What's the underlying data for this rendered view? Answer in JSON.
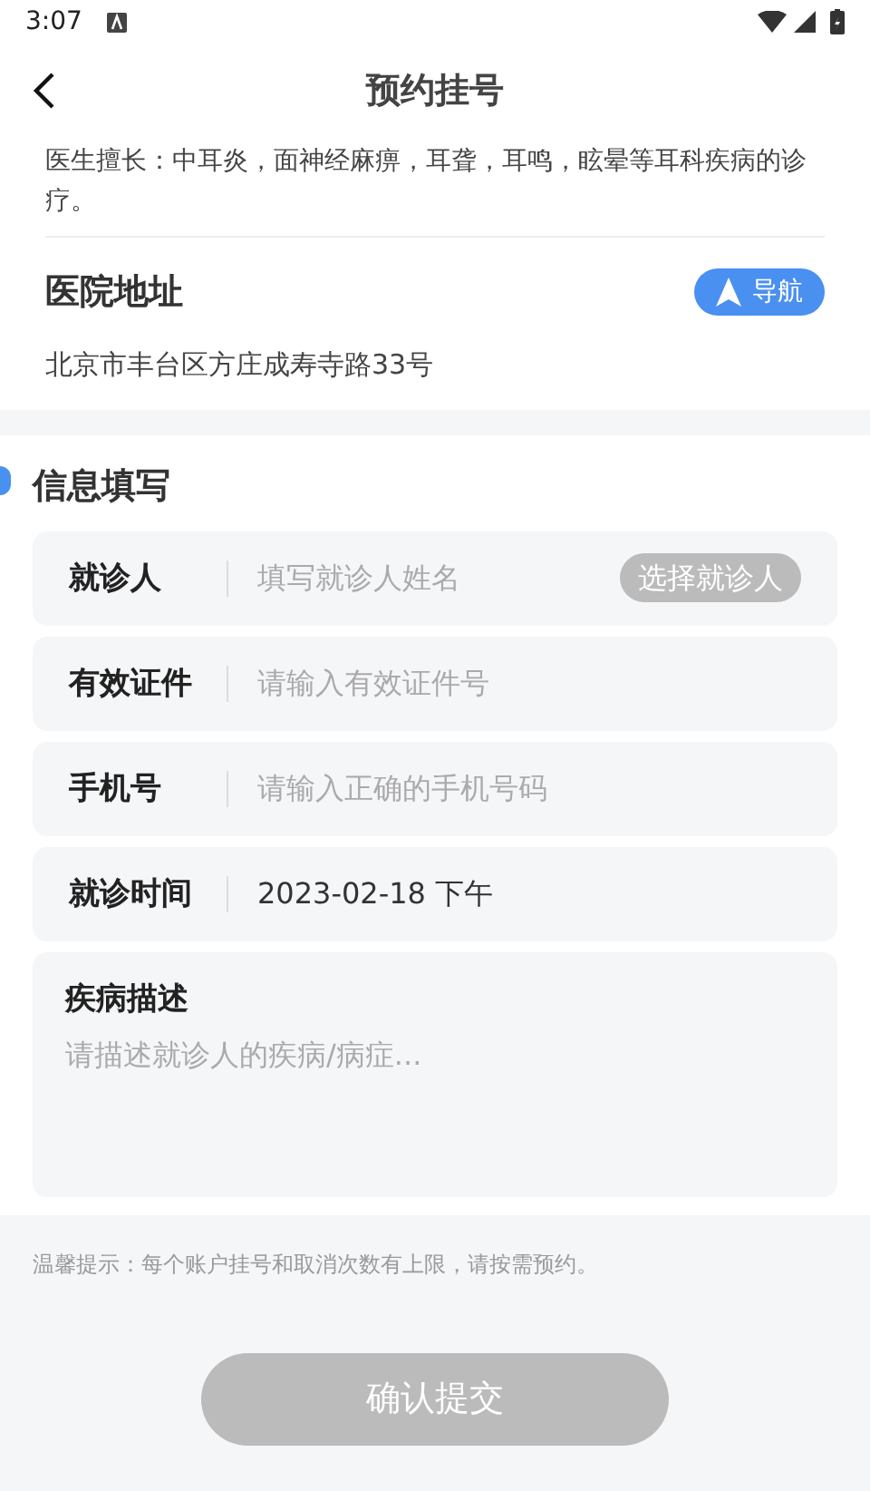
{
  "status_bar": {
    "time": "3:07"
  },
  "header": {
    "title": "预约挂号"
  },
  "doctor": {
    "specialty_text": "医生擅长：中耳炎，面神经麻痹，耳聋，耳鸣，眩晕等耳科疾病的诊疗。"
  },
  "hospital": {
    "title": "医院地址",
    "nav_button": "导航",
    "address": "北京市丰台区方庄成寿寺路33号"
  },
  "form": {
    "title": "信息填写",
    "rows": [
      {
        "kind": "input",
        "label": "就诊人",
        "placeholder": "填写就诊人姓名",
        "action": "选择就诊人"
      },
      {
        "kind": "input",
        "label": "有效证件",
        "placeholder": "请输入有效证件号"
      },
      {
        "kind": "input",
        "label": "手机号",
        "placeholder": "请输入正确的手机号码"
      },
      {
        "kind": "input",
        "label": "就诊时间",
        "value": "2023-02-18 下午"
      }
    ],
    "description": {
      "label": "疾病描述",
      "placeholder": "请描述就诊人的疾病/病症..."
    }
  },
  "tip": "温馨提示：每个账户挂号和取消次数有上限，请按需预约。",
  "submit": {
    "label": "确认提交",
    "disabled": true
  }
}
